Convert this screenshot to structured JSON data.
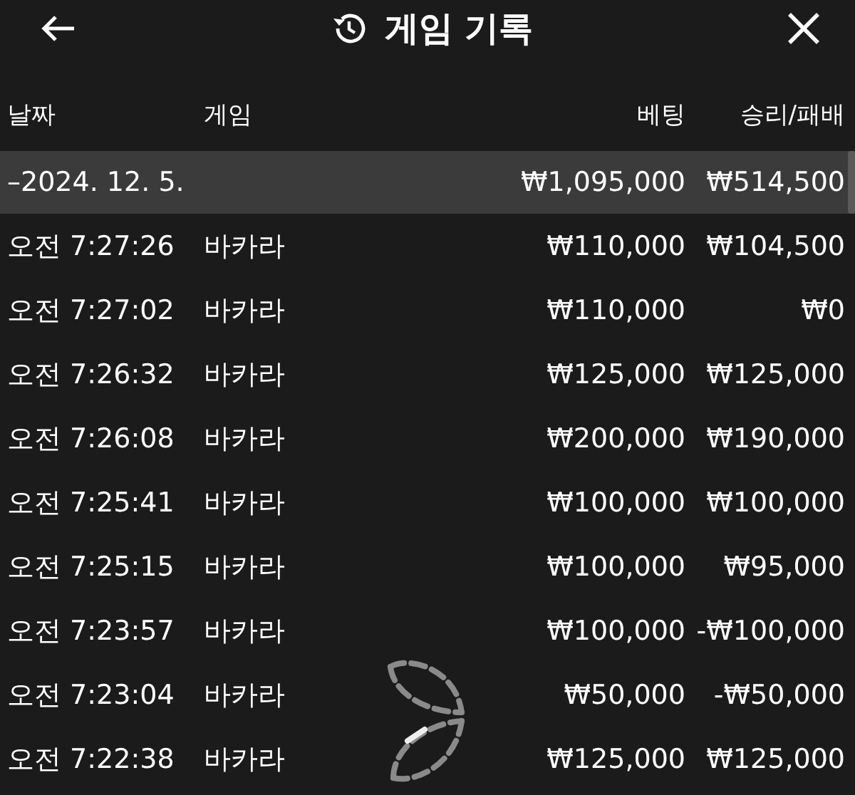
{
  "header": {
    "title": "게임 기록"
  },
  "table": {
    "columns": [
      "날짜",
      "게임",
      "베팅",
      "승리/패배"
    ],
    "group": {
      "date": "–2024. 12. 5.",
      "bet": "₩1,095,000",
      "result": "₩514,500"
    },
    "rows": [
      {
        "time": "오전 7:27:26",
        "game": "바카라",
        "bet": "₩110,000",
        "result": "₩104,500"
      },
      {
        "time": "오전 7:27:02",
        "game": "바카라",
        "bet": "₩110,000",
        "result": "₩0"
      },
      {
        "time": "오전 7:26:32",
        "game": "바카라",
        "bet": "₩125,000",
        "result": "₩125,000"
      },
      {
        "time": "오전 7:26:08",
        "game": "바카라",
        "bet": "₩200,000",
        "result": "₩190,000"
      },
      {
        "time": "오전 7:25:41",
        "game": "바카라",
        "bet": "₩100,000",
        "result": "₩100,000"
      },
      {
        "time": "오전 7:25:15",
        "game": "바카라",
        "bet": "₩100,000",
        "result": "₩95,000"
      },
      {
        "time": "오전 7:23:57",
        "game": "바카라",
        "bet": "₩100,000",
        "result": "-₩100,000"
      },
      {
        "time": "오전 7:23:04",
        "game": "바카라",
        "bet": "₩50,000",
        "result": "-₩50,000"
      },
      {
        "time": "오전 7:22:38",
        "game": "바카라",
        "bet": "₩125,000",
        "result": "₩125,000"
      }
    ]
  }
}
